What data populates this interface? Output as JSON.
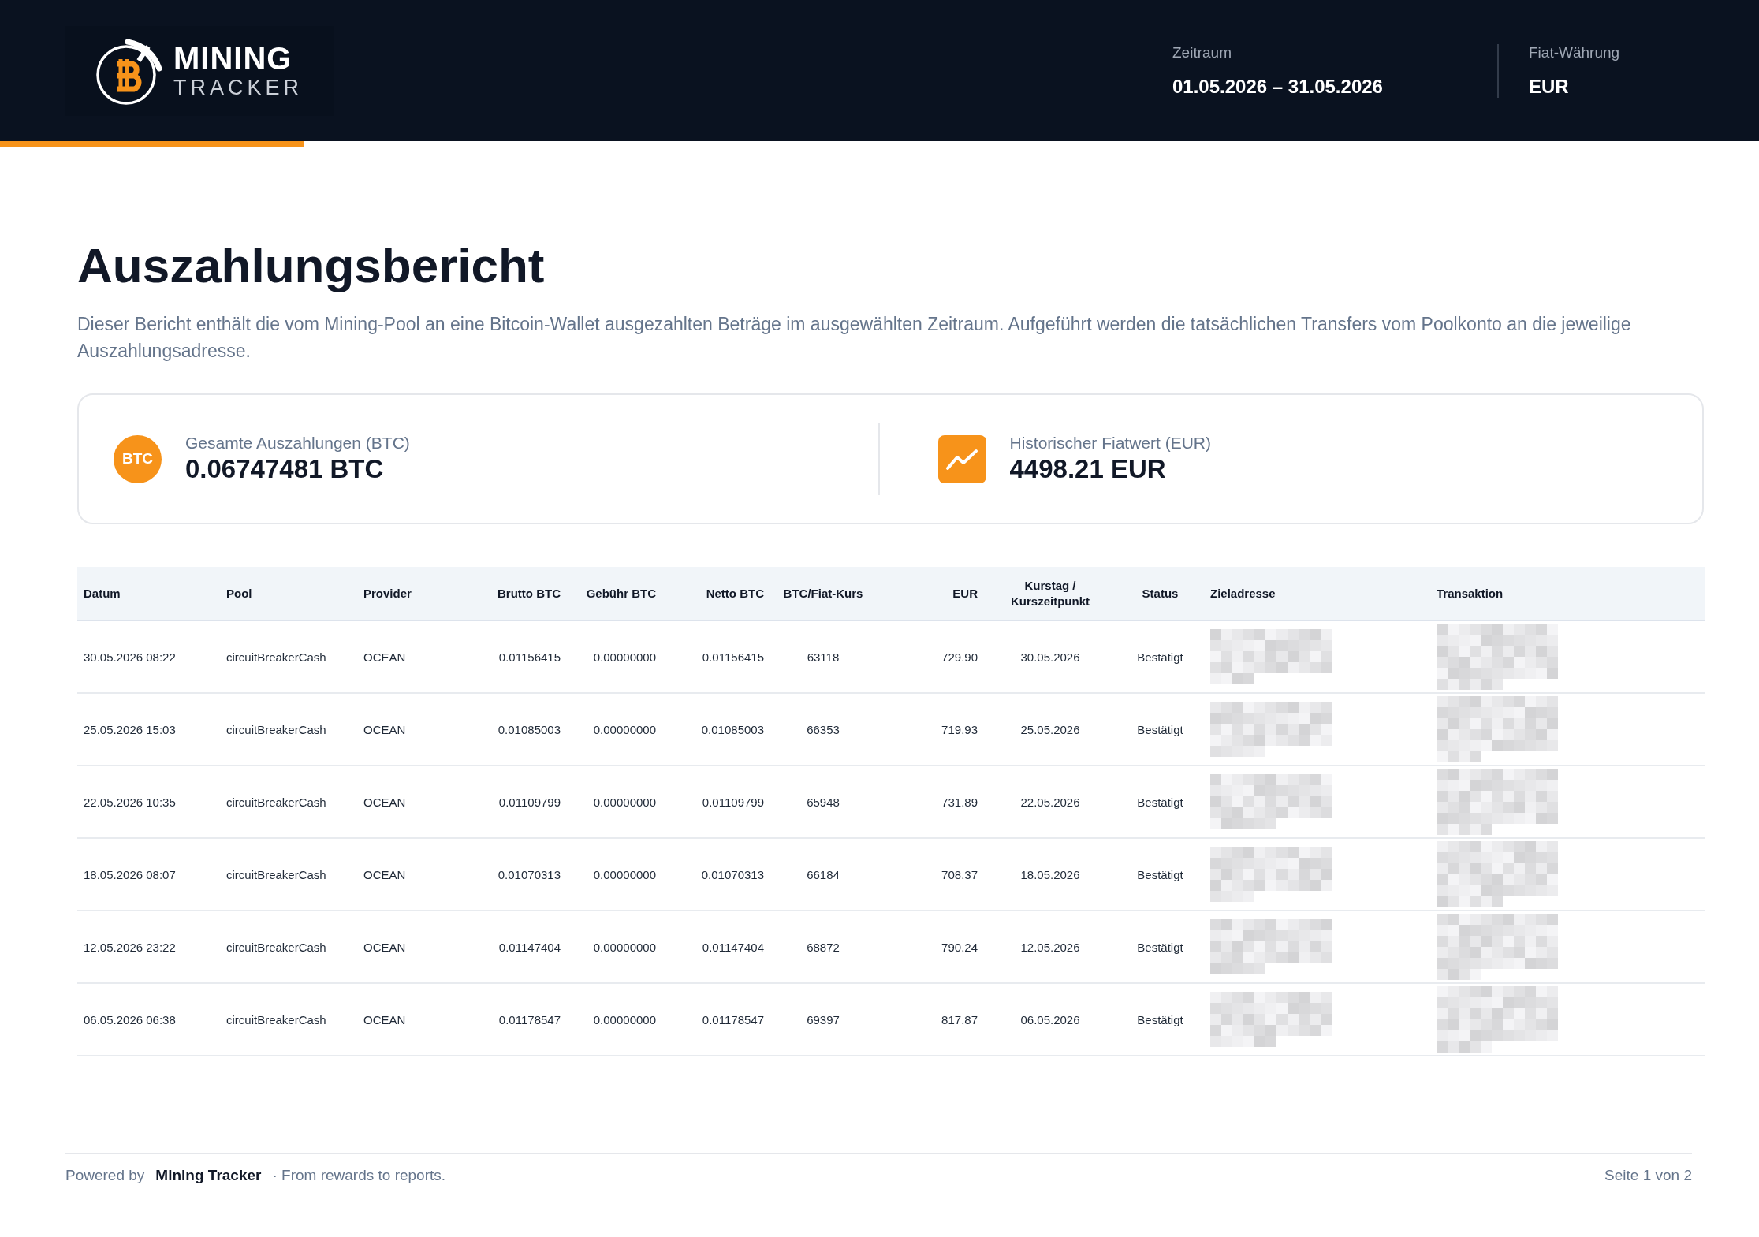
{
  "header": {
    "logo": {
      "line1": "MINING",
      "line2": "TRACKER"
    },
    "meta": [
      {
        "label": "Zeitraum",
        "value": "01.05.2026 – 31.05.2026"
      },
      {
        "label": "Fiat-Währung",
        "value": "EUR"
      }
    ]
  },
  "title": "Auszahlungsbericht",
  "description": "Dieser Bericht enthält die vom Mining-Pool an eine Bitcoin-Wallet ausgezahlten Beträge im ausgewählten Zeitraum. Aufgeführt werden die tatsächlichen Transfers vom Poolkonto an die jeweilige Auszahlungsadresse.",
  "summary": [
    {
      "kind": "coin",
      "badge": "BTC",
      "label": "Gesamte Auszahlungen (BTC)",
      "value": "0.06747481 BTC"
    },
    {
      "kind": "chart",
      "label": "Historischer Fiatwert (EUR)",
      "value": "4498.21 EUR"
    }
  ],
  "table": {
    "columns": [
      "Datum",
      "Pool",
      "Provider",
      "Brutto BTC",
      "Gebühr BTC",
      "Netto BTC",
      "BTC/Fiat-Kurs",
      "EUR",
      "Kurstag / Kurszeitpunkt",
      "Status",
      "Zieladresse",
      "Transaktion"
    ],
    "rows": [
      {
        "datum": "30.05.2026 08:22",
        "pool": "circuitBreakerCash",
        "provider": "OCEAN",
        "brutto": "0.01156415",
        "gebuehr": "0.00000000",
        "netto": "0.01156415",
        "kurs": "63118",
        "eur": "729.90",
        "kurstag": "30.05.2026",
        "status": "Bestätigt"
      },
      {
        "datum": "25.05.2026 15:03",
        "pool": "circuitBreakerCash",
        "provider": "OCEAN",
        "brutto": "0.01085003",
        "gebuehr": "0.00000000",
        "netto": "0.01085003",
        "kurs": "66353",
        "eur": "719.93",
        "kurstag": "25.05.2026",
        "status": "Bestätigt"
      },
      {
        "datum": "22.05.2026 10:35",
        "pool": "circuitBreakerCash",
        "provider": "OCEAN",
        "brutto": "0.01109799",
        "gebuehr": "0.00000000",
        "netto": "0.01109799",
        "kurs": "65948",
        "eur": "731.89",
        "kurstag": "22.05.2026",
        "status": "Bestätigt"
      },
      {
        "datum": "18.05.2026 08:07",
        "pool": "circuitBreakerCash",
        "provider": "OCEAN",
        "brutto": "0.01070313",
        "gebuehr": "0.00000000",
        "netto": "0.01070313",
        "kurs": "66184",
        "eur": "708.37",
        "kurstag": "18.05.2026",
        "status": "Bestätigt"
      },
      {
        "datum": "12.05.2026 23:22",
        "pool": "circuitBreakerCash",
        "provider": "OCEAN",
        "brutto": "0.01147404",
        "gebuehr": "0.00000000",
        "netto": "0.01147404",
        "kurs": "68872",
        "eur": "790.24",
        "kurstag": "12.05.2026",
        "status": "Bestätigt"
      },
      {
        "datum": "06.05.2026 06:38",
        "pool": "circuitBreakerCash",
        "provider": "OCEAN",
        "brutto": "0.01178547",
        "gebuehr": "0.00000000",
        "netto": "0.01178547",
        "kurs": "69397",
        "eur": "817.87",
        "kurstag": "06.05.2026",
        "status": "Bestätigt"
      }
    ]
  },
  "footer": {
    "prefix": "Powered by",
    "brand": "Mining Tracker",
    "tagline": "· From rewards to reports.",
    "page": "Seite 1 von 2"
  }
}
